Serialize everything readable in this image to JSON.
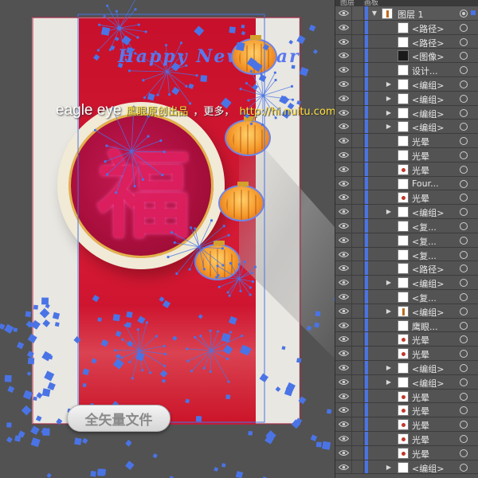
{
  "panel": {
    "tabs": [
      "图层",
      "画板"
    ],
    "layers": [
      {
        "name": "图层 1",
        "expand": "open",
        "thumb": "brand",
        "top": true,
        "sel": true
      },
      {
        "name": "<路径>",
        "expand": "",
        "thumb": "plain",
        "sel": false
      },
      {
        "name": "<路径>",
        "expand": "",
        "thumb": "plain",
        "sel": false
      },
      {
        "name": "<图像>",
        "expand": "",
        "thumb": "dark",
        "sel": false
      },
      {
        "name": "设计...",
        "expand": "",
        "thumb": "plain",
        "sel": false
      },
      {
        "name": "<编组>",
        "expand": "closed",
        "thumb": "plain",
        "sel": false
      },
      {
        "name": "<编组>",
        "expand": "closed",
        "thumb": "plain",
        "sel": false
      },
      {
        "name": "<编组>",
        "expand": "closed",
        "thumb": "plain",
        "sel": false
      },
      {
        "name": "<编组>",
        "expand": "closed",
        "thumb": "plain",
        "sel": false
      },
      {
        "name": "光晕",
        "expand": "",
        "thumb": "plain",
        "sel": false
      },
      {
        "name": "光晕",
        "expand": "",
        "thumb": "plain",
        "sel": false
      },
      {
        "name": "光晕",
        "expand": "",
        "thumb": "dot",
        "sel": false
      },
      {
        "name": "Four...",
        "expand": "",
        "thumb": "plain",
        "sel": false
      },
      {
        "name": "光晕",
        "expand": "",
        "thumb": "dot",
        "sel": false
      },
      {
        "name": "<编组>",
        "expand": "closed",
        "thumb": "plain",
        "sel": false
      },
      {
        "name": "<复...",
        "expand": "",
        "thumb": "plain",
        "sel": false
      },
      {
        "name": "<复...",
        "expand": "",
        "thumb": "plain",
        "sel": false
      },
      {
        "name": "<复...",
        "expand": "",
        "thumb": "plain",
        "sel": false
      },
      {
        "name": "<路径>",
        "expand": "",
        "thumb": "plain",
        "sel": false
      },
      {
        "name": "<编组>",
        "expand": "closed",
        "thumb": "plain",
        "sel": false
      },
      {
        "name": "<复...",
        "expand": "",
        "thumb": "plain",
        "sel": false
      },
      {
        "name": "<编组>",
        "expand": "closed",
        "thumb": "mark",
        "sel": false
      },
      {
        "name": "鹰眼...",
        "expand": "",
        "thumb": "plain",
        "sel": false
      },
      {
        "name": "光晕",
        "expand": "",
        "thumb": "dot",
        "sel": false
      },
      {
        "name": "光晕",
        "expand": "",
        "thumb": "dot",
        "sel": false
      },
      {
        "name": "<编组>",
        "expand": "closed",
        "thumb": "plain",
        "sel": false
      },
      {
        "name": "<编组>",
        "expand": "closed",
        "thumb": "plain",
        "sel": false
      },
      {
        "name": "光晕",
        "expand": "",
        "thumb": "dot",
        "sel": false
      },
      {
        "name": "光晕",
        "expand": "",
        "thumb": "dot",
        "sel": false
      },
      {
        "name": "光晕",
        "expand": "",
        "thumb": "dot",
        "sel": false
      },
      {
        "name": "光晕",
        "expand": "",
        "thumb": "dot",
        "sel": false
      },
      {
        "name": "光晕",
        "expand": "",
        "thumb": "dot",
        "sel": false
      },
      {
        "name": "<编组>",
        "expand": "closed",
        "thumb": "plain",
        "sel": false
      }
    ]
  },
  "canvas": {
    "title_art": "Happy New Year",
    "fu_char": "福",
    "watermark": {
      "logo": "eagle eye",
      "slogan": "鹰眼原创出品",
      "more": "，更多，",
      "url": "http://hi.nuitu.com/369/"
    },
    "badge": "全矢量文件"
  },
  "colors": {
    "selection_blue": "#4a74e6",
    "poster_red": "#c7102b",
    "panel_bg": "#535353"
  }
}
